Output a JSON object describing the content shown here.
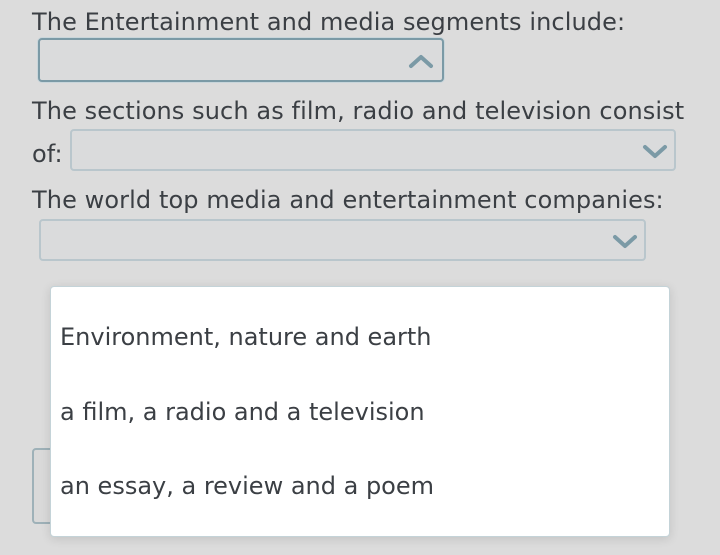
{
  "questions": [
    {
      "label": "The Entertainment and media segments include:",
      "selected": "",
      "state": "open",
      "icon": "chevron-up-icon"
    },
    {
      "label_line1": "The sections such as film, radio and television consist",
      "label_line2": "of:",
      "selected": "",
      "state": "closed",
      "icon": "chevron-down-icon"
    },
    {
      "label": "The world top media and entertainment companies:",
      "selected": "",
      "state": "closed",
      "icon": "chevron-down-icon"
    }
  ],
  "dropdown": {
    "options": [
      "Environment, nature and earth",
      "a film, a radio and a television",
      "an essay, a review and a poem"
    ]
  },
  "colors": {
    "background": "#dcdcdc",
    "text": "#3b3f44",
    "accent": "#7b9aa6"
  }
}
